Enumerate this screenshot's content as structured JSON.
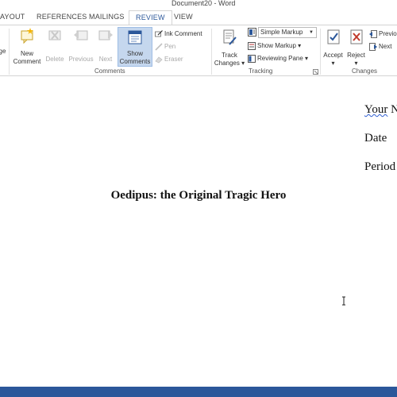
{
  "window": {
    "title": "Document20 - Word"
  },
  "tabs": [
    {
      "label": "AYOUT"
    },
    {
      "label": "REFERENCES"
    },
    {
      "label": "MAILINGS"
    },
    {
      "label": "REVIEW"
    },
    {
      "label": "VIEW"
    }
  ],
  "ribbon": {
    "comments": {
      "group_label": "Comments",
      "left_fragment": "ge",
      "new": "New\nComment",
      "new_line1": "New",
      "new_line2": "Comment",
      "delete": "Delete",
      "previous": "Previous",
      "next": "Next",
      "show_line1": "Show",
      "show_line2": "Comments",
      "ink_comment": "Ink Comment",
      "pen": "Pen",
      "eraser": "Eraser"
    },
    "tracking": {
      "group_label": "Tracking",
      "track_line1": "Track",
      "track_line2": "Changes",
      "markup_select": "Simple Markup",
      "show_markup": "Show Markup",
      "reviewing_pane": "Reviewing Pane"
    },
    "changes": {
      "group_label": "Changes",
      "accept": "Accept",
      "reject": "Reject",
      "previous": "Previo",
      "next": "Next"
    }
  },
  "document": {
    "header_lines": [
      "Your N",
      "Date",
      "Period"
    ],
    "header_first_word": "Your",
    "header_first_rest": " N",
    "title": "Oedipus: the Original Tragic Hero"
  },
  "colors": {
    "accent": "#2b579a",
    "selected_bg": "#c5d7ee",
    "spell_squiggle": "#2f5ed1"
  }
}
